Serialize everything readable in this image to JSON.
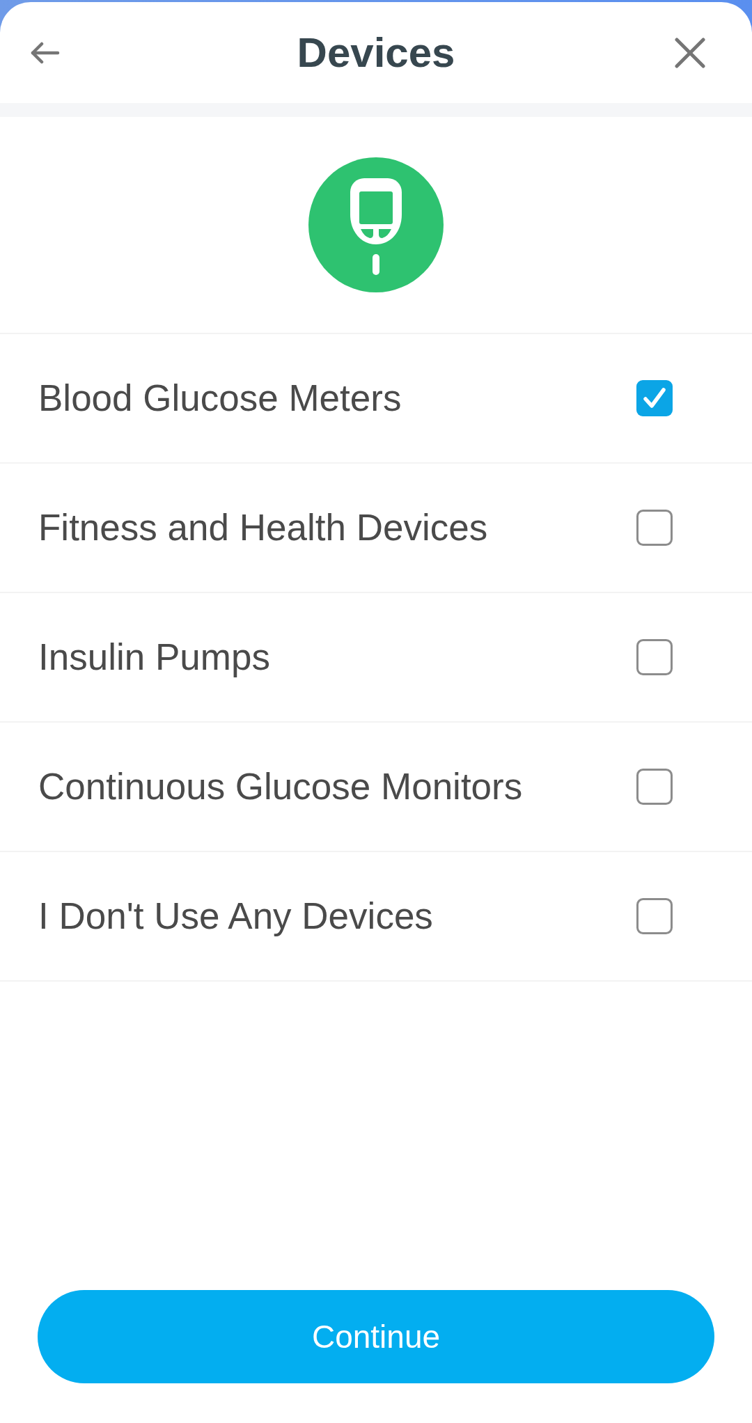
{
  "header": {
    "title": "Devices"
  },
  "options": [
    {
      "label": "Blood Glucose Meters",
      "checked": true
    },
    {
      "label": "Fitness and Health Devices",
      "checked": false
    },
    {
      "label": "Insulin Pumps",
      "checked": false
    },
    {
      "label": "Continuous Glucose Monitors",
      "checked": false
    },
    {
      "label": "I Don't Use Any Devices",
      "checked": false
    }
  ],
  "continue_button": {
    "label": "Continue"
  }
}
